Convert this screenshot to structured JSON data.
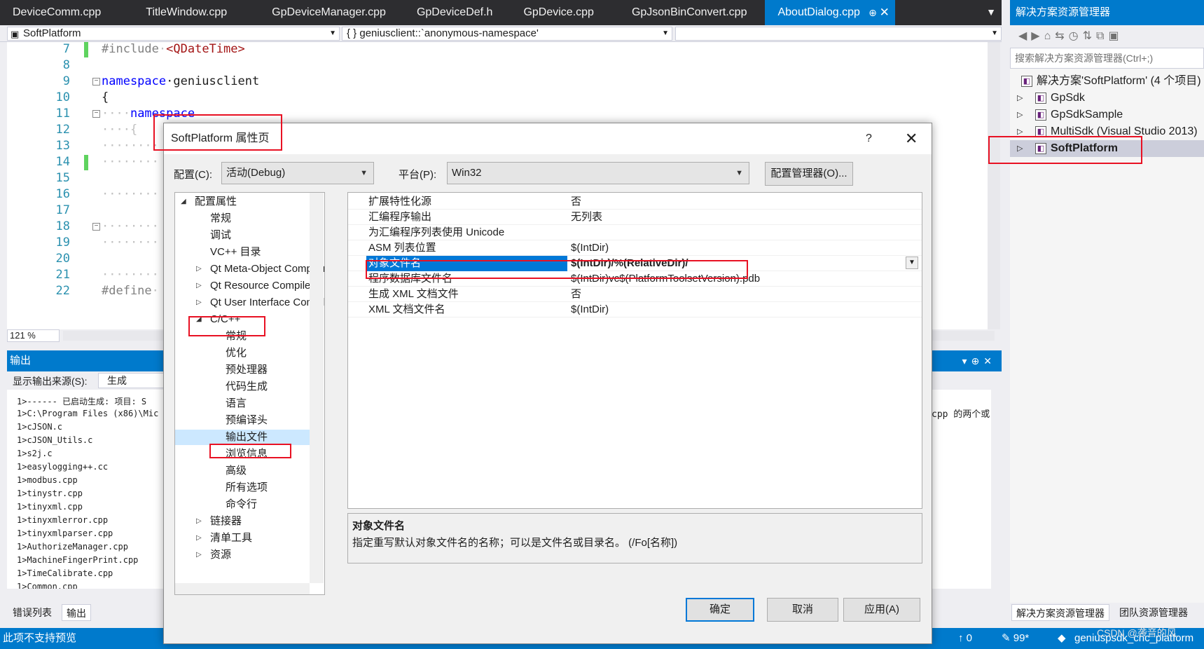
{
  "tabs": [
    "DeviceComm.cpp",
    "TitleWindow.cpp",
    "GpDeviceManager.cpp",
    "GpDeviceDef.h",
    "GpDevice.cpp",
    "GpJsonBinConvert.cpp",
    "AboutDialog.cpp"
  ],
  "nav": {
    "project": "SoftPlatform",
    "scope": "{ } geniusclient::`anonymous-namespace'"
  },
  "editor": {
    "line_numbers": [
      "7",
      "8",
      "9",
      "10",
      "11",
      "12",
      "13",
      "14",
      "15",
      "16",
      "17",
      "18",
      "19",
      "20",
      "21",
      "22"
    ],
    "include_kw": "#include",
    "include_dot": "·",
    "include_val": "<QDateTime>",
    "ns_kw": "namespace",
    "ns_name": "·geniusclient",
    "brace": "{",
    "ns2_dots": "····",
    "ns2_kw": "namespace",
    "brace2": "····{",
    "dots": "········",
    "define_kw": "#define",
    "define_dot": "·",
    "zoom": "121 %"
  },
  "output": {
    "title": "输出",
    "source_label": "显示输出来源(S):",
    "source_value": "生成",
    "lines": [
      "1>------ 已启动生成: 项目: S",
      "1>C:\\Program Files (x86)\\Mic",
      "1>cJSON.c",
      "1>cJSON_Utils.c",
      "1>s2j.c",
      "1>easylogging++.cc",
      "1>modbus.cpp",
      "1>tinystr.cpp",
      "1>tinyxml.cpp",
      "1>tinyxmlerror.cpp",
      "1>tinyxmlparser.cpp",
      "1>AuthorizeManager.cpp",
      "1>MachineFingerPrint.cpp",
      "1>TimeCalibrate.cpp",
      "1>Common.cpp"
    ],
    "right_fragment": "cpp 的两个或",
    "tab_errors": "错误列表",
    "tab_output": "输出"
  },
  "solution": {
    "title": "解决方案资源管理器",
    "search_placeholder": "搜索解决方案资源管理器(Ctrl+;)",
    "items": [
      "解决方案'SoftPlatform' (4 个项目)",
      "GpSdk",
      "GpSdkSample",
      "MultiSdk (Visual Studio 2013)",
      "SoftPlatform"
    ],
    "tab_solution": "解决方案资源管理器",
    "tab_team": "团队资源管理器"
  },
  "status": {
    "left": "此项不支持预览",
    "up": "↑ 0",
    "edits": "✎ 99*",
    "branch": "geniuspsdk_cnc_platform",
    "watermark": "CSDN @袭音的风"
  },
  "dialog": {
    "title": "SoftPlatform 属性页",
    "help": "?",
    "close": "✕",
    "config_label": "配置(C):",
    "config_value": "活动(Debug)",
    "platform_label": "平台(P):",
    "platform_value": "Win32",
    "config_manager": "配置管理器(O)...",
    "tree": [
      "配置属性",
      "常规",
      "调试",
      "VC++ 目录",
      "Qt Meta-Object Compiler",
      "Qt Resource Compiler",
      "Qt User Interface Compiler",
      "C/C++",
      "常规",
      "优化",
      "预处理器",
      "代码生成",
      "语言",
      "预编译头",
      "输出文件",
      "浏览信息",
      "高级",
      "所有选项",
      "命令行",
      "链接器",
      "清单工具",
      "资源"
    ],
    "props": [
      {
        "name": "扩展特性化源",
        "value": "否"
      },
      {
        "name": "汇编程序输出",
        "value": "无列表"
      },
      {
        "name": "为汇编程序列表使用 Unicode",
        "value": ""
      },
      {
        "name": "ASM 列表位置",
        "value": "$(IntDir)"
      },
      {
        "name": "对象文件名",
        "value": "$(IntDir)/%(RelativeDir)/"
      },
      {
        "name": "程序数据库文件名",
        "value": "$(IntDir)vc$(PlatformToolsetVersion).pdb"
      },
      {
        "name": "生成 XML 文档文件",
        "value": "否"
      },
      {
        "name": "XML 文档文件名",
        "value": "$(IntDir)"
      }
    ],
    "desc_title": "对象文件名",
    "desc_body": "指定重写默认对象文件名的名称；可以是文件名或目录名。     (/Fo[名称])",
    "ok": "确定",
    "cancel": "取消",
    "apply": "应用(A)"
  }
}
